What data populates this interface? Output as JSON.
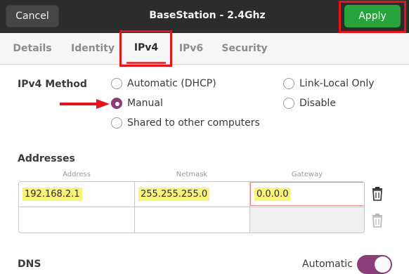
{
  "header": {
    "cancel_label": "Cancel",
    "title": "BaseStation - 2.4Ghz",
    "apply_label": "Apply"
  },
  "tabs": [
    {
      "label": "Details",
      "active": false
    },
    {
      "label": "Identity",
      "active": false
    },
    {
      "label": "IPv4",
      "active": true
    },
    {
      "label": "IPv6",
      "active": false
    },
    {
      "label": "Security",
      "active": false
    }
  ],
  "ipv4": {
    "method_label": "IPv4 Method",
    "methods": [
      {
        "label": "Automatic (DHCP)",
        "checked": false
      },
      {
        "label": "Link-Local Only",
        "checked": false
      },
      {
        "label": "Manual",
        "checked": true
      },
      {
        "label": "Disable",
        "checked": false
      },
      {
        "label": "Shared to other computers",
        "checked": false
      }
    ]
  },
  "addresses": {
    "section_label": "Addresses",
    "columns": [
      "Address",
      "Netmask",
      "Gateway"
    ],
    "rows": [
      {
        "address": "192.168.2.1",
        "netmask": "255.255.255.0",
        "gateway": "0.0.0.0"
      },
      {
        "address": "",
        "netmask": "",
        "gateway": ""
      }
    ]
  },
  "dns": {
    "label": "DNS",
    "automatic_label": "Automatic",
    "automatic_on": true
  },
  "colors": {
    "accent": "#8b3d79",
    "apply_green": "#26a33a",
    "annotation_red": "#e8121b",
    "highlight_yellow": "#f8f37a"
  }
}
